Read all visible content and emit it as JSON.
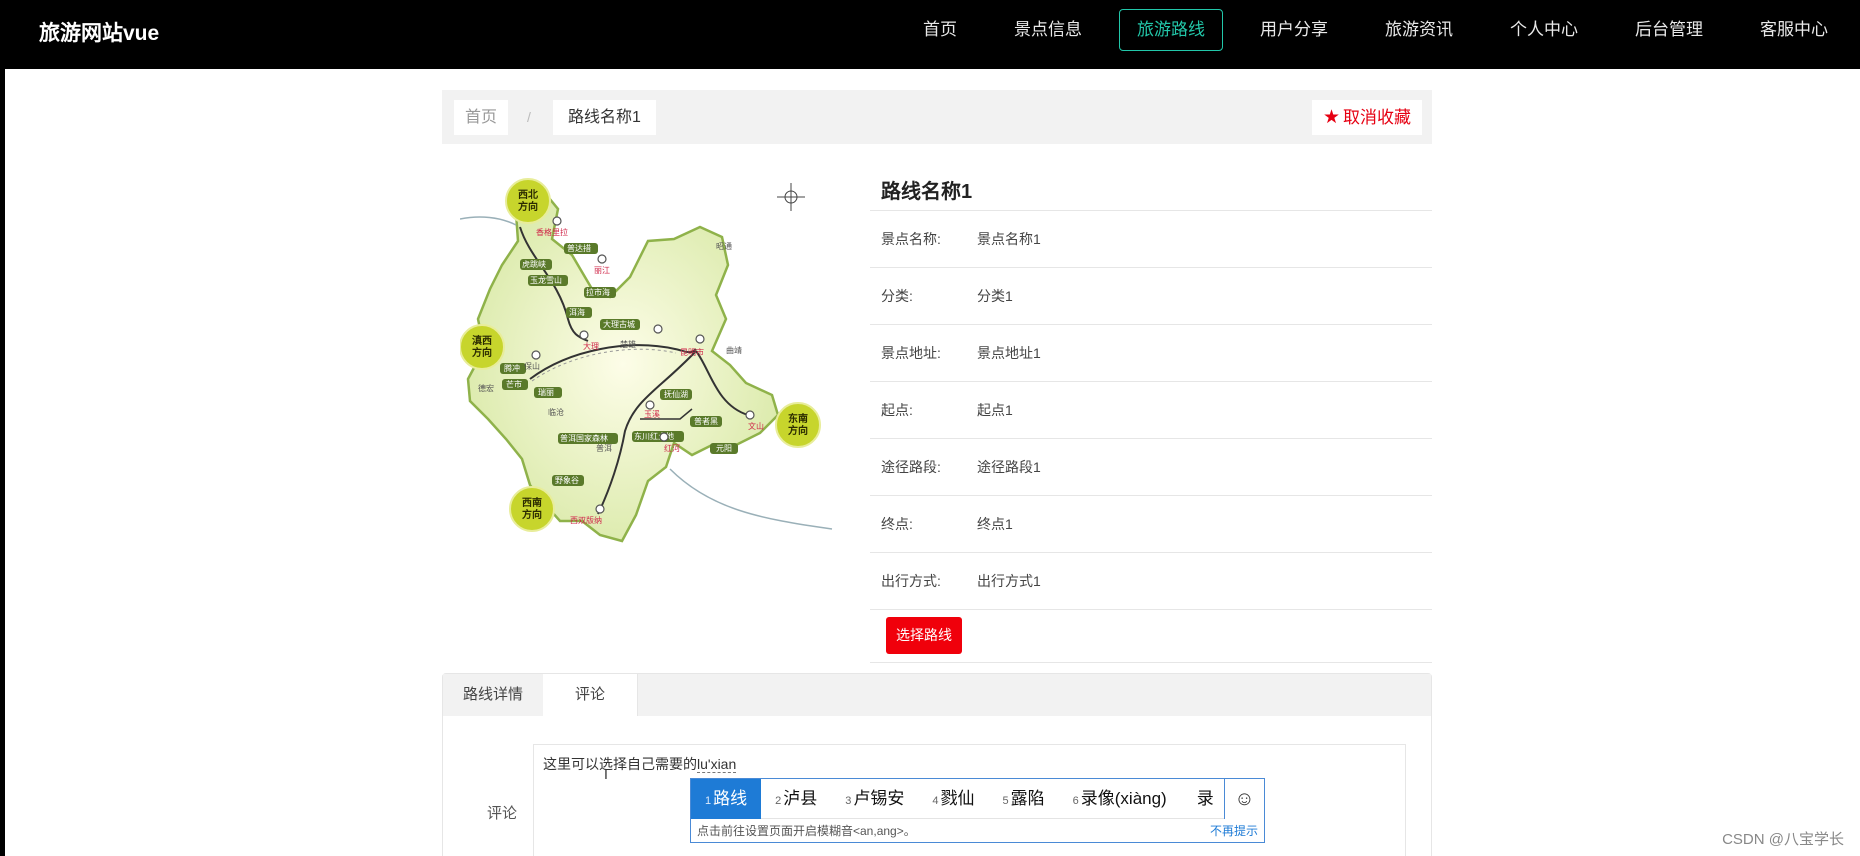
{
  "app": {
    "brand": "旅游网站vue"
  },
  "nav": {
    "items": [
      {
        "label": "首页"
      },
      {
        "label": "景点信息"
      },
      {
        "label": "旅游路线"
      },
      {
        "label": "用户分享"
      },
      {
        "label": "旅游资讯"
      },
      {
        "label": "个人中心"
      },
      {
        "label": "后台管理"
      },
      {
        "label": "客服中心"
      }
    ],
    "active": "旅游路线"
  },
  "breadcrumb": {
    "home": "首页",
    "separator": "/",
    "current": "路线名称1"
  },
  "favorite": {
    "label": "取消收藏"
  },
  "map": {
    "regions": [
      "西北方向",
      "滇西方向",
      "东南方向",
      "西南方向"
    ],
    "places": [
      "香格里拉",
      "普达措",
      "虎跳峡",
      "丽江",
      "玉龙雪山",
      "拉市海",
      "洱海",
      "大理古城",
      "大理",
      "楚雄",
      "昆明市",
      "曲靖",
      "昭通",
      "瑞丽",
      "保山",
      "腾冲",
      "芒市",
      "德宏",
      "临沧",
      "玉溪",
      "抚仙湖",
      "普者黑",
      "文山",
      "东川红土地",
      "普洱国家森林",
      "红河",
      "普洱",
      "元阳",
      "野象谷",
      "西双版纳"
    ]
  },
  "route": {
    "title": "路线名称1",
    "fields": [
      {
        "label": "景点名称:",
        "value": "景点名称1"
      },
      {
        "label": "分类:",
        "value": "分类1"
      },
      {
        "label": "景点地址:",
        "value": "景点地址1"
      },
      {
        "label": "起点:",
        "value": "起点1"
      },
      {
        "label": "途径路段:",
        "value": "途径路段1"
      },
      {
        "label": "终点:",
        "value": "终点1"
      },
      {
        "label": "出行方式:",
        "value": "出行方式1"
      }
    ],
    "select_button": "选择路线"
  },
  "tabs": [
    {
      "label": "路线详情"
    },
    {
      "label": "评论"
    }
  ],
  "comment": {
    "label": "评论",
    "text_before": "这里可以选择自己需要的",
    "composing": "lu'xian"
  },
  "ime": {
    "candidates": [
      {
        "num": "1",
        "text": "路线"
      },
      {
        "num": "2",
        "text": "泸县"
      },
      {
        "num": "3",
        "text": "卢锡安"
      },
      {
        "num": "4",
        "text": "戮仙"
      },
      {
        "num": "5",
        "text": "露陷"
      },
      {
        "num": "6",
        "text": "录像(xiàng)"
      },
      {
        "num": "",
        "text": "录"
      }
    ],
    "tip": "点击前往设置页面开启模糊音<an,ang>。",
    "dismiss": "不再提示"
  },
  "watermark": "CSDN @八宝学长",
  "colors": {
    "accent": "#22c7a9",
    "danger": "#f0000b",
    "ime_select": "#1e7bd6"
  }
}
